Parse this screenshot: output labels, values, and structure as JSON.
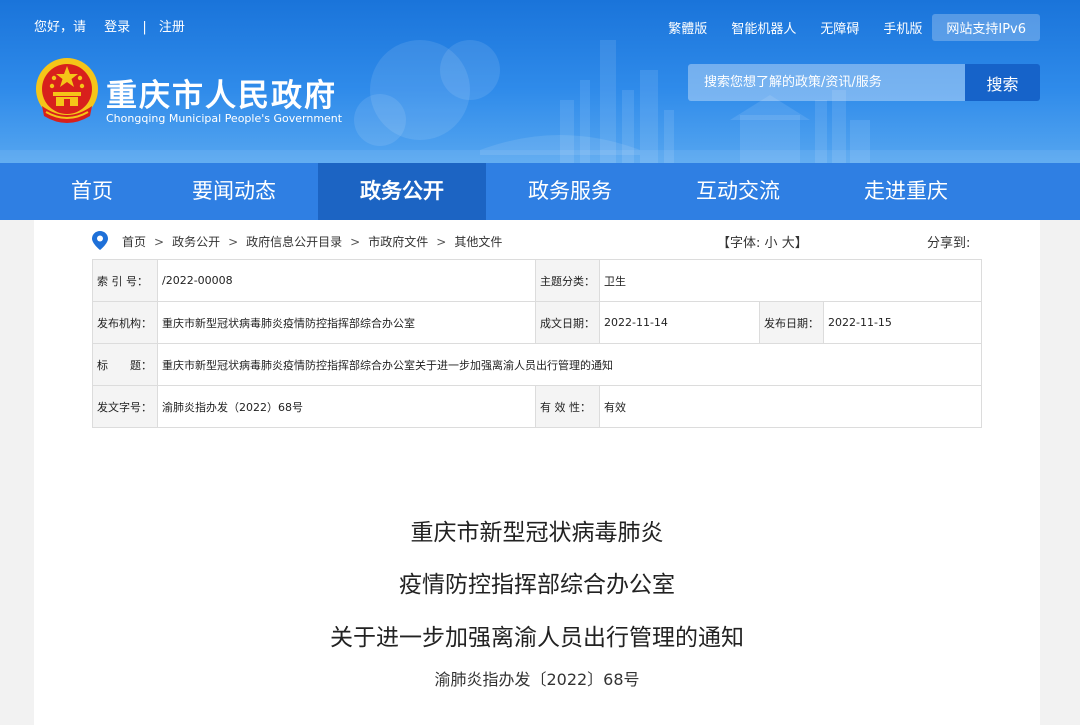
{
  "topbar": {
    "greeting": "您好，请",
    "login": "登录",
    "separator": "|",
    "register": "注册",
    "links": [
      "繁體版",
      "智能机器人",
      "无障碍",
      "手机版"
    ],
    "ipv6": "网站支持IPv6"
  },
  "site": {
    "title": "重庆市人民政府",
    "subtitle": "Chongqing Municipal People's Government",
    "emblem_icon": "national-emblem-icon"
  },
  "search": {
    "placeholder": "搜索您想了解的政策/资讯/服务",
    "button": "搜索"
  },
  "nav": {
    "items": [
      "首页",
      "要闻动态",
      "政务公开",
      "政务服务",
      "互动交流",
      "走进重庆"
    ],
    "active_index": 2
  },
  "breadcrumb": {
    "icon": "location-pin-icon",
    "items": [
      "首页",
      "政务公开",
      "政府信息公开目录",
      "市政府文件",
      "其他文件"
    ],
    "separator": ">"
  },
  "font_size": {
    "prefix": "【字体:",
    "small": "小",
    "large": "大",
    "suffix": "】"
  },
  "share": "分享到:",
  "meta": {
    "index_label": "索 引 号：",
    "index_value": "/2022-00008",
    "category_label": "主题分类：",
    "category_value": "卫生",
    "issuer_label": "发布机构：",
    "issuer_value": "重庆市新型冠状病毒肺炎疫情防控指挥部综合办公室",
    "written_label": "成文日期：",
    "written_value": "2022-11-14",
    "published_label": "发布日期：",
    "published_value": "2022-11-15",
    "title_label": "标　　题：",
    "title_value": "重庆市新型冠状病毒肺炎疫情防控指挥部综合办公室关于进一步加强离渝人员出行管理的通知",
    "docno_label": "发文字号：",
    "docno_value": "渝肺炎指办发（2022）68号",
    "validity_label": "有 效 性：",
    "validity_value": "有效"
  },
  "document": {
    "title_lines": [
      "重庆市新型冠状病毒肺炎",
      "疫情防控指挥部综合办公室",
      "关于进一步加强离渝人员出行管理的通知"
    ],
    "number": "渝肺炎指办发〔2022〕68号"
  },
  "colors": {
    "header_blue": "#1a74da",
    "nav_blue": "#2f7fe3",
    "nav_active": "#1c64c3",
    "search_button": "#1663c9"
  }
}
